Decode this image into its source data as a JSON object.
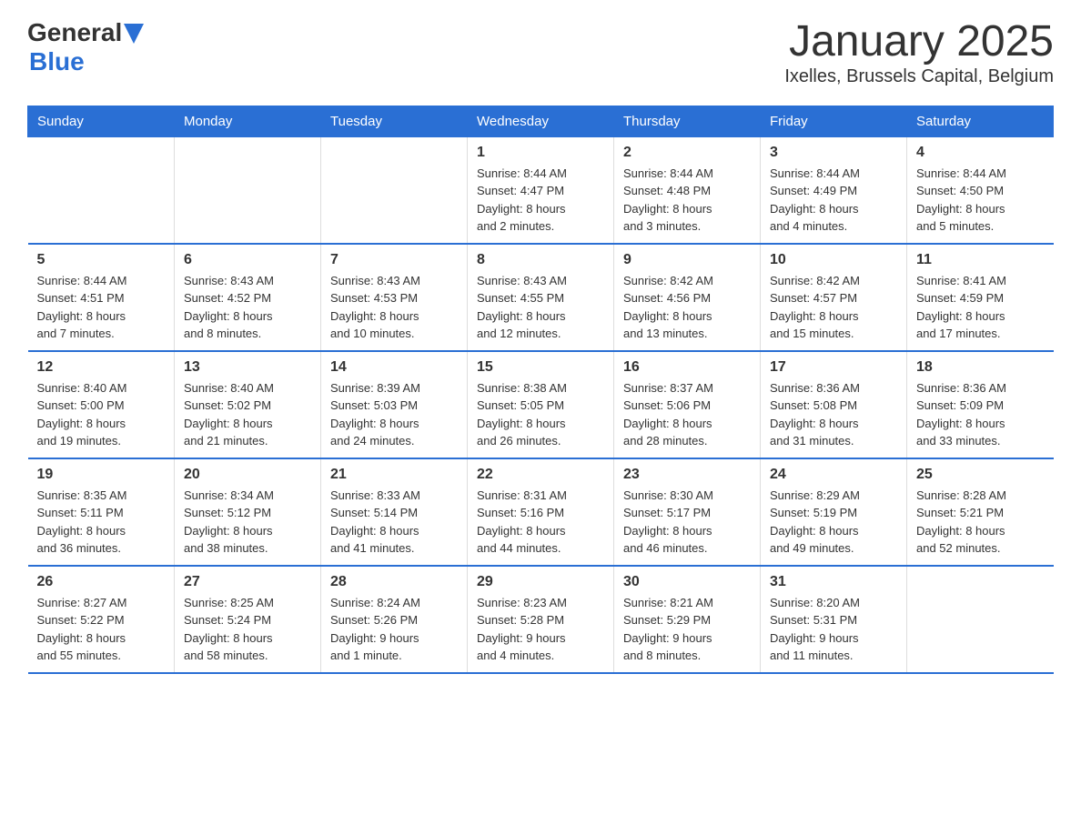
{
  "header": {
    "logo_general": "General",
    "logo_blue": "Blue",
    "title": "January 2025",
    "subtitle": "Ixelles, Brussels Capital, Belgium"
  },
  "days_of_week": [
    "Sunday",
    "Monday",
    "Tuesday",
    "Wednesday",
    "Thursday",
    "Friday",
    "Saturday"
  ],
  "weeks": [
    [
      {
        "day": "",
        "info": ""
      },
      {
        "day": "",
        "info": ""
      },
      {
        "day": "",
        "info": ""
      },
      {
        "day": "1",
        "info": "Sunrise: 8:44 AM\nSunset: 4:47 PM\nDaylight: 8 hours\nand 2 minutes."
      },
      {
        "day": "2",
        "info": "Sunrise: 8:44 AM\nSunset: 4:48 PM\nDaylight: 8 hours\nand 3 minutes."
      },
      {
        "day": "3",
        "info": "Sunrise: 8:44 AM\nSunset: 4:49 PM\nDaylight: 8 hours\nand 4 minutes."
      },
      {
        "day": "4",
        "info": "Sunrise: 8:44 AM\nSunset: 4:50 PM\nDaylight: 8 hours\nand 5 minutes."
      }
    ],
    [
      {
        "day": "5",
        "info": "Sunrise: 8:44 AM\nSunset: 4:51 PM\nDaylight: 8 hours\nand 7 minutes."
      },
      {
        "day": "6",
        "info": "Sunrise: 8:43 AM\nSunset: 4:52 PM\nDaylight: 8 hours\nand 8 minutes."
      },
      {
        "day": "7",
        "info": "Sunrise: 8:43 AM\nSunset: 4:53 PM\nDaylight: 8 hours\nand 10 minutes."
      },
      {
        "day": "8",
        "info": "Sunrise: 8:43 AM\nSunset: 4:55 PM\nDaylight: 8 hours\nand 12 minutes."
      },
      {
        "day": "9",
        "info": "Sunrise: 8:42 AM\nSunset: 4:56 PM\nDaylight: 8 hours\nand 13 minutes."
      },
      {
        "day": "10",
        "info": "Sunrise: 8:42 AM\nSunset: 4:57 PM\nDaylight: 8 hours\nand 15 minutes."
      },
      {
        "day": "11",
        "info": "Sunrise: 8:41 AM\nSunset: 4:59 PM\nDaylight: 8 hours\nand 17 minutes."
      }
    ],
    [
      {
        "day": "12",
        "info": "Sunrise: 8:40 AM\nSunset: 5:00 PM\nDaylight: 8 hours\nand 19 minutes."
      },
      {
        "day": "13",
        "info": "Sunrise: 8:40 AM\nSunset: 5:02 PM\nDaylight: 8 hours\nand 21 minutes."
      },
      {
        "day": "14",
        "info": "Sunrise: 8:39 AM\nSunset: 5:03 PM\nDaylight: 8 hours\nand 24 minutes."
      },
      {
        "day": "15",
        "info": "Sunrise: 8:38 AM\nSunset: 5:05 PM\nDaylight: 8 hours\nand 26 minutes."
      },
      {
        "day": "16",
        "info": "Sunrise: 8:37 AM\nSunset: 5:06 PM\nDaylight: 8 hours\nand 28 minutes."
      },
      {
        "day": "17",
        "info": "Sunrise: 8:36 AM\nSunset: 5:08 PM\nDaylight: 8 hours\nand 31 minutes."
      },
      {
        "day": "18",
        "info": "Sunrise: 8:36 AM\nSunset: 5:09 PM\nDaylight: 8 hours\nand 33 minutes."
      }
    ],
    [
      {
        "day": "19",
        "info": "Sunrise: 8:35 AM\nSunset: 5:11 PM\nDaylight: 8 hours\nand 36 minutes."
      },
      {
        "day": "20",
        "info": "Sunrise: 8:34 AM\nSunset: 5:12 PM\nDaylight: 8 hours\nand 38 minutes."
      },
      {
        "day": "21",
        "info": "Sunrise: 8:33 AM\nSunset: 5:14 PM\nDaylight: 8 hours\nand 41 minutes."
      },
      {
        "day": "22",
        "info": "Sunrise: 8:31 AM\nSunset: 5:16 PM\nDaylight: 8 hours\nand 44 minutes."
      },
      {
        "day": "23",
        "info": "Sunrise: 8:30 AM\nSunset: 5:17 PM\nDaylight: 8 hours\nand 46 minutes."
      },
      {
        "day": "24",
        "info": "Sunrise: 8:29 AM\nSunset: 5:19 PM\nDaylight: 8 hours\nand 49 minutes."
      },
      {
        "day": "25",
        "info": "Sunrise: 8:28 AM\nSunset: 5:21 PM\nDaylight: 8 hours\nand 52 minutes."
      }
    ],
    [
      {
        "day": "26",
        "info": "Sunrise: 8:27 AM\nSunset: 5:22 PM\nDaylight: 8 hours\nand 55 minutes."
      },
      {
        "day": "27",
        "info": "Sunrise: 8:25 AM\nSunset: 5:24 PM\nDaylight: 8 hours\nand 58 minutes."
      },
      {
        "day": "28",
        "info": "Sunrise: 8:24 AM\nSunset: 5:26 PM\nDaylight: 9 hours\nand 1 minute."
      },
      {
        "day": "29",
        "info": "Sunrise: 8:23 AM\nSunset: 5:28 PM\nDaylight: 9 hours\nand 4 minutes."
      },
      {
        "day": "30",
        "info": "Sunrise: 8:21 AM\nSunset: 5:29 PM\nDaylight: 9 hours\nand 8 minutes."
      },
      {
        "day": "31",
        "info": "Sunrise: 8:20 AM\nSunset: 5:31 PM\nDaylight: 9 hours\nand 11 minutes."
      },
      {
        "day": "",
        "info": ""
      }
    ]
  ]
}
